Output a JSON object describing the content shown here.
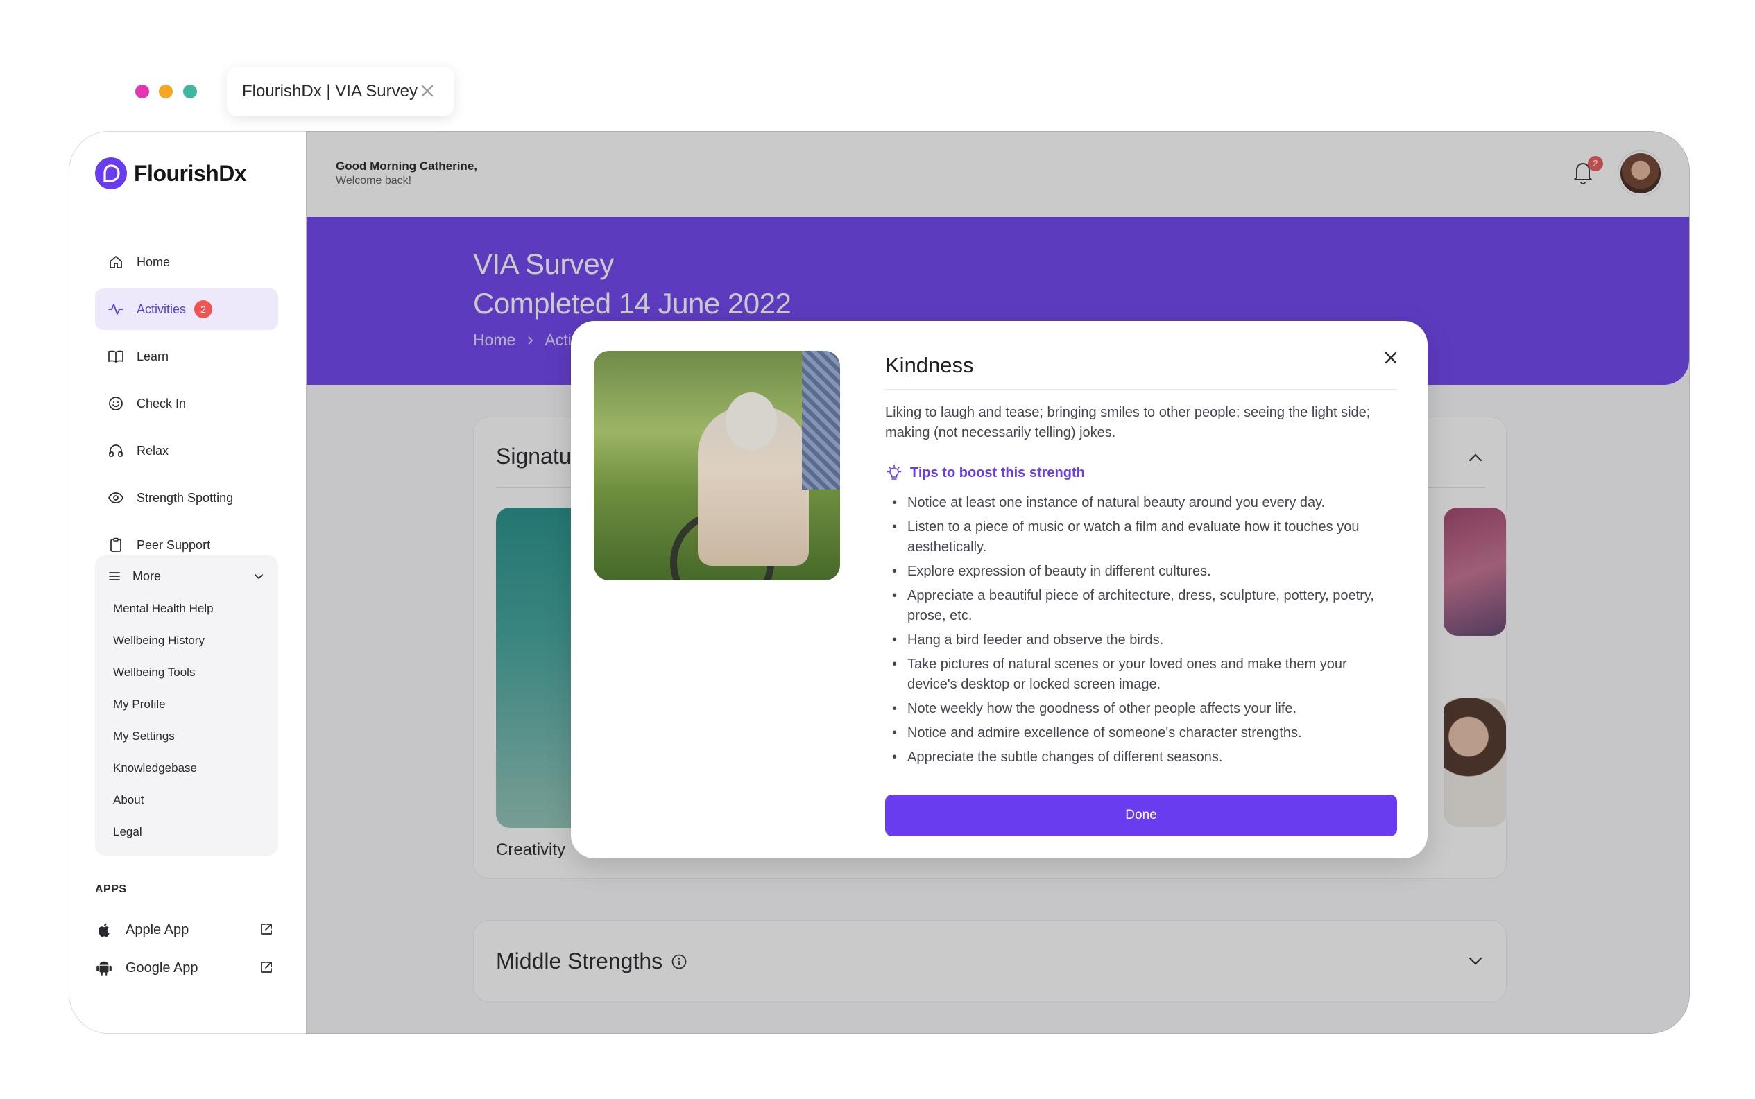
{
  "browser": {
    "tab_title": "FlourishDx | VIA Survey",
    "dot_colors": [
      "#e535b4",
      "#f5a623",
      "#3fb8a0"
    ]
  },
  "brand": {
    "name": "FlourishDx",
    "accent": "#6a3cf0"
  },
  "sidebar": {
    "items": [
      {
        "label": "Home",
        "icon": "home-icon"
      },
      {
        "label": "Activities",
        "icon": "activity-icon",
        "badge": "2",
        "active": true
      },
      {
        "label": "Learn",
        "icon": "book-icon"
      },
      {
        "label": "Check In",
        "icon": "smile-icon"
      },
      {
        "label": "Relax",
        "icon": "headphones-icon"
      },
      {
        "label": "Strength Spotting",
        "icon": "eye-icon"
      },
      {
        "label": "Peer Support",
        "icon": "clipboard-icon"
      }
    ],
    "more": {
      "label": "More",
      "items": [
        "Mental Health Help",
        "Wellbeing History",
        "Wellbeing Tools",
        "My Profile",
        "My Settings",
        "Knowledgebase",
        "About",
        "Legal"
      ]
    },
    "apps_title": "APPS",
    "apps": [
      {
        "label": "Apple App",
        "icon": "apple-icon"
      },
      {
        "label": "Google App",
        "icon": "android-icon"
      }
    ]
  },
  "header": {
    "greeting": "Good Morning Catherine,",
    "sub": "Welcome back!",
    "notification_count": "2"
  },
  "hero": {
    "title": "VIA Survey",
    "subtitle": "Completed 14 June 2022",
    "breadcrumb": [
      "Home",
      "Acti"
    ]
  },
  "sections": {
    "signature_title": "Signatu",
    "first_strength": "Creativity",
    "middle_title": "Middle Strengths"
  },
  "modal": {
    "title": "Kindness",
    "description": "Liking to laugh and tease; bringing smiles to other people; seeing the light side; making (not necessarily telling) jokes.",
    "tips_title": "Tips to boost this strength",
    "tips": [
      "Notice at least one instance of natural beauty around you every day.",
      "Listen to a piece of music or watch a film and evaluate how it touches you aesthetically.",
      "Explore expression of beauty in different cultures.",
      "Appreciate a beautiful piece of architecture, dress, sculpture, pottery, poetry, prose, etc.",
      "Hang a bird feeder and observe the birds.",
      "Take pictures of natural scenes or your loved ones and make them your device's desktop or locked screen image.",
      "Note weekly how the goodness of other people affects your life.",
      "Notice and admire excellence of someone's character strengths.",
      "Appreciate the subtle changes of different seasons."
    ],
    "done_label": "Done"
  }
}
